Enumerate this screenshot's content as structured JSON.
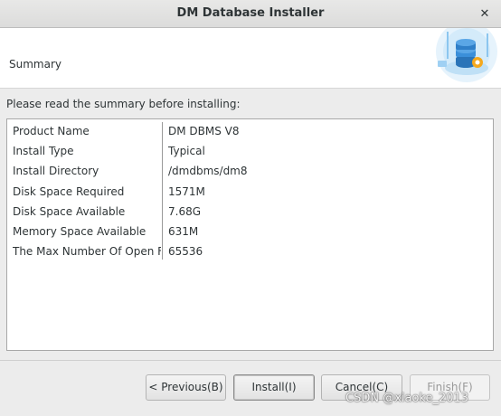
{
  "window": {
    "title": "DM Database Installer",
    "close_glyph": "✕"
  },
  "header": {
    "title": "Summary",
    "graphic_icon": "database-server-icon"
  },
  "instructions": "Please read the summary before installing:",
  "summary": {
    "rows": [
      {
        "key": "Product Name",
        "value": "DM DBMS V8"
      },
      {
        "key": "Install Type",
        "value": "Typical"
      },
      {
        "key": "Install Directory",
        "value": "/dmdbms/dm8"
      },
      {
        "key": "Disk Space Required",
        "value": "1571M"
      },
      {
        "key": "Disk Space Available",
        "value": "7.68G"
      },
      {
        "key": "Memory Space Available",
        "value": "631M"
      },
      {
        "key": "The Max Number Of Open File",
        "value": "65536"
      }
    ]
  },
  "buttons": {
    "previous": "< Previous(B)",
    "install": "Install(I)",
    "cancel": "Cancel(C)",
    "finish": "Finish(F)"
  },
  "watermark": "CSDN @xiaoke_2013",
  "colors": {
    "graphic_blue": "#3b8fd9",
    "graphic_light": "#dbeefb",
    "graphic_orange": "#f4a81d"
  }
}
